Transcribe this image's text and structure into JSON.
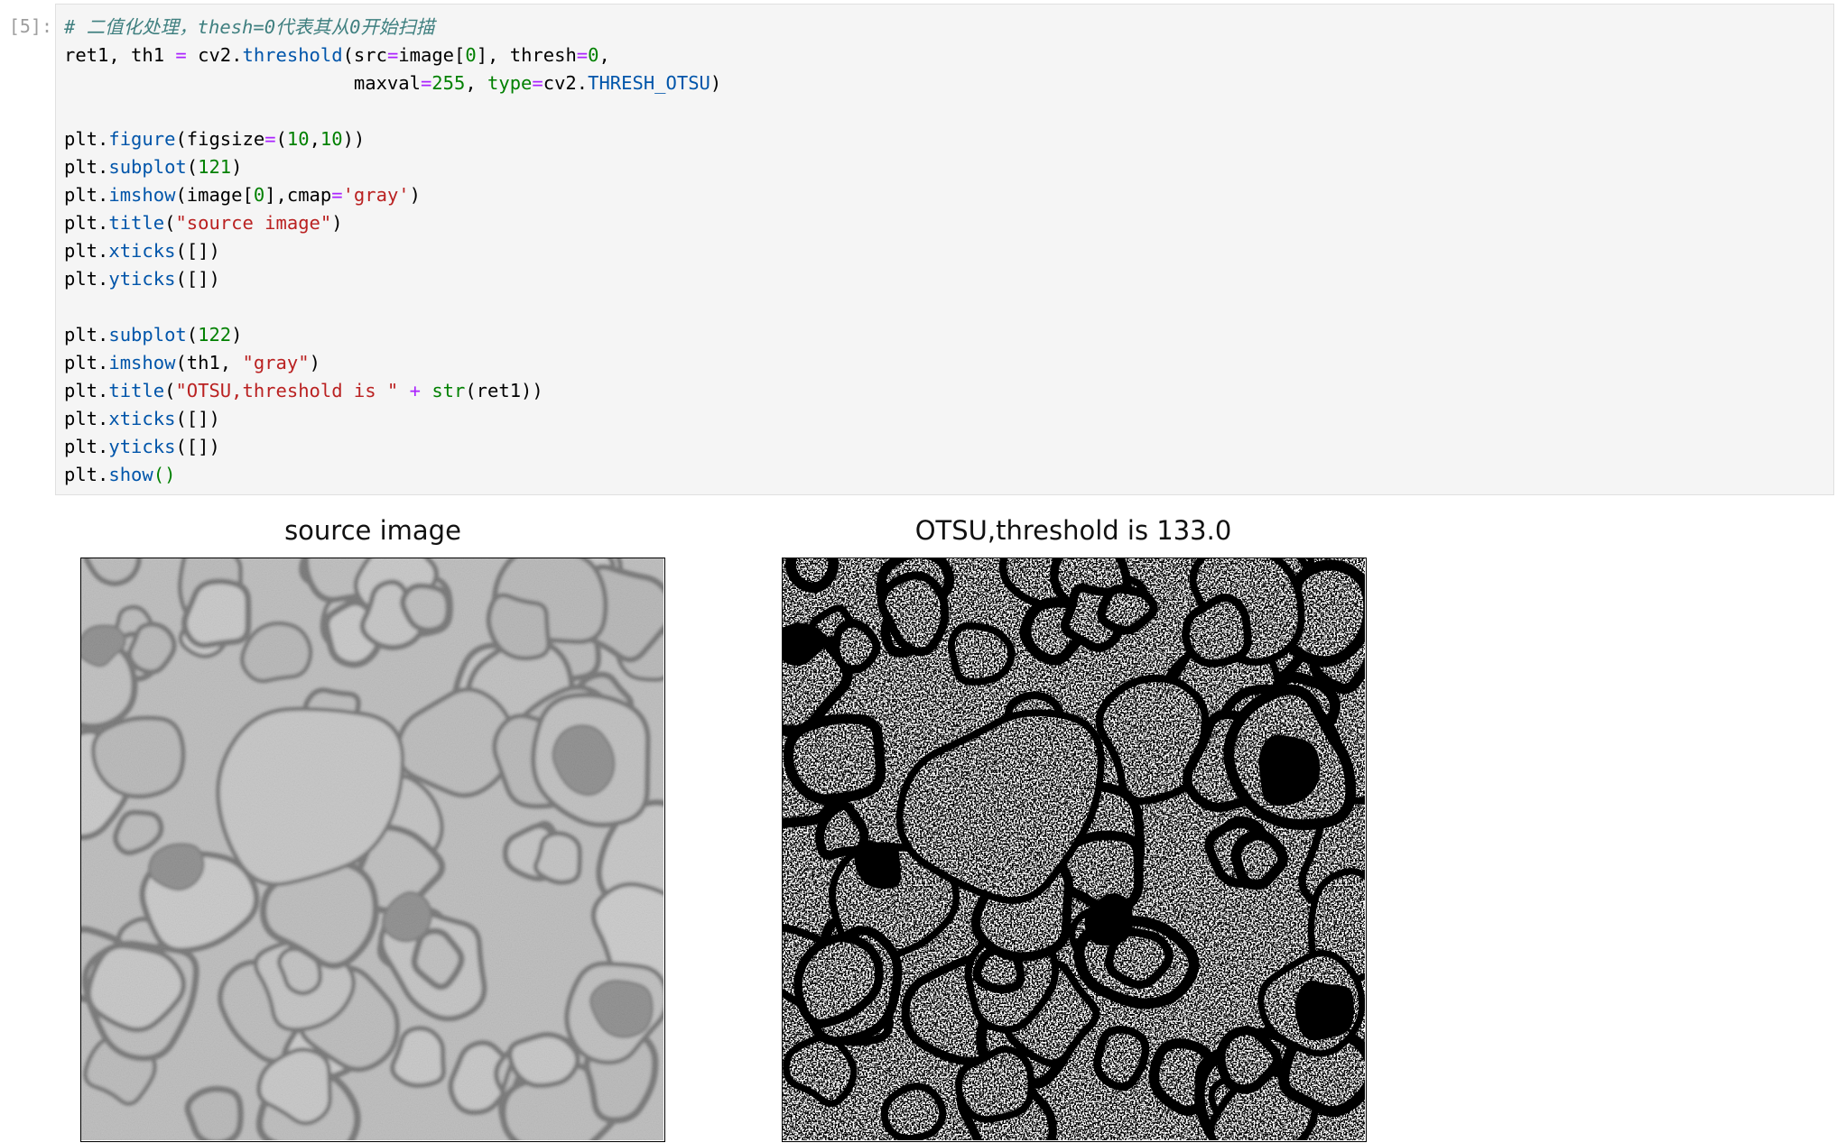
{
  "cell": {
    "prompt": "[5]:",
    "code_lines": [
      [
        [
          "tok-comment",
          "# 二值化处理，thesh=0代表其从0开始扫描"
        ]
      ],
      [
        [
          "",
          "ret1, th1 "
        ],
        [
          "tok-op",
          "="
        ],
        [
          "",
          " cv2."
        ],
        [
          "tok-fn",
          "threshold"
        ],
        [
          "",
          "(src"
        ],
        [
          "tok-op",
          "="
        ],
        [
          "",
          "image["
        ],
        [
          "tok-num",
          "0"
        ],
        [
          "",
          "], thresh"
        ],
        [
          "tok-op",
          "="
        ],
        [
          "tok-num",
          "0"
        ],
        [
          "",
          ","
        ]
      ],
      [
        [
          "",
          "                          maxval"
        ],
        [
          "tok-op",
          "="
        ],
        [
          "tok-num",
          "255"
        ],
        [
          "",
          ", "
        ],
        [
          "tok-kw",
          "type"
        ],
        [
          "tok-op",
          "="
        ],
        [
          "",
          "cv2."
        ],
        [
          "tok-attr",
          "THRESH_OTSU"
        ],
        [
          "",
          ")"
        ]
      ],
      [
        [
          "",
          ""
        ]
      ],
      [
        [
          "",
          "plt."
        ],
        [
          "tok-fn",
          "figure"
        ],
        [
          "",
          "(figsize"
        ],
        [
          "tok-op",
          "="
        ],
        [
          "",
          "("
        ],
        [
          "tok-num",
          "10"
        ],
        [
          "",
          ","
        ],
        [
          "tok-num",
          "10"
        ],
        [
          "",
          "))"
        ]
      ],
      [
        [
          "",
          "plt."
        ],
        [
          "tok-fn",
          "subplot"
        ],
        [
          "",
          "("
        ],
        [
          "tok-num",
          "121"
        ],
        [
          "",
          ")"
        ]
      ],
      [
        [
          "",
          "plt."
        ],
        [
          "tok-fn",
          "imshow"
        ],
        [
          "",
          "(image["
        ],
        [
          "tok-num",
          "0"
        ],
        [
          "",
          "],cmap"
        ],
        [
          "tok-op",
          "="
        ],
        [
          "tok-str",
          "'gray'"
        ],
        [
          "",
          ")"
        ]
      ],
      [
        [
          "",
          "plt."
        ],
        [
          "tok-fn",
          "title"
        ],
        [
          "",
          "("
        ],
        [
          "tok-str",
          "\"source image\""
        ],
        [
          "",
          ")"
        ]
      ],
      [
        [
          "",
          "plt."
        ],
        [
          "tok-fn",
          "xticks"
        ],
        [
          "",
          "([])"
        ]
      ],
      [
        [
          "",
          "plt."
        ],
        [
          "tok-fn",
          "yticks"
        ],
        [
          "",
          "([])"
        ]
      ],
      [
        [
          "",
          ""
        ]
      ],
      [
        [
          "",
          "plt."
        ],
        [
          "tok-fn",
          "subplot"
        ],
        [
          "",
          "("
        ],
        [
          "tok-num",
          "122"
        ],
        [
          "",
          ")"
        ]
      ],
      [
        [
          "",
          "plt."
        ],
        [
          "tok-fn",
          "imshow"
        ],
        [
          "",
          "(th1, "
        ],
        [
          "tok-str",
          "\"gray\""
        ],
        [
          "",
          ")"
        ]
      ],
      [
        [
          "",
          "plt."
        ],
        [
          "tok-fn",
          "title"
        ],
        [
          "",
          "("
        ],
        [
          "tok-str",
          "\"OTSU,threshold is \""
        ],
        [
          "",
          " "
        ],
        [
          "tok-op",
          "+"
        ],
        [
          "",
          " "
        ],
        [
          "tok-builtin",
          "str"
        ],
        [
          "",
          "(ret1))"
        ]
      ],
      [
        [
          "",
          "plt."
        ],
        [
          "tok-fn",
          "xticks"
        ],
        [
          "",
          "([])"
        ]
      ],
      [
        [
          "",
          "plt."
        ],
        [
          "tok-fn",
          "yticks"
        ],
        [
          "",
          "([])"
        ]
      ],
      [
        [
          "",
          "plt."
        ],
        [
          "tok-fn",
          "show"
        ],
        [
          "tok-builtin",
          "()"
        ]
      ]
    ]
  },
  "output": {
    "left_title": "source image",
    "right_title": "OTSU,threshold is 133.0",
    "left_image_kind": "grayscale electron micrograph of cell membranes",
    "right_image_kind": "binary thresholded image (black and white)"
  },
  "colors": {
    "cell_background": "#f5f5f5",
    "cell_border": "#e0e0e0",
    "prompt": "#9e9e9e",
    "comment": "#408080",
    "operator": "#aa22ff",
    "number": "#008000",
    "string": "#ba2121",
    "function": "#0055aa"
  }
}
